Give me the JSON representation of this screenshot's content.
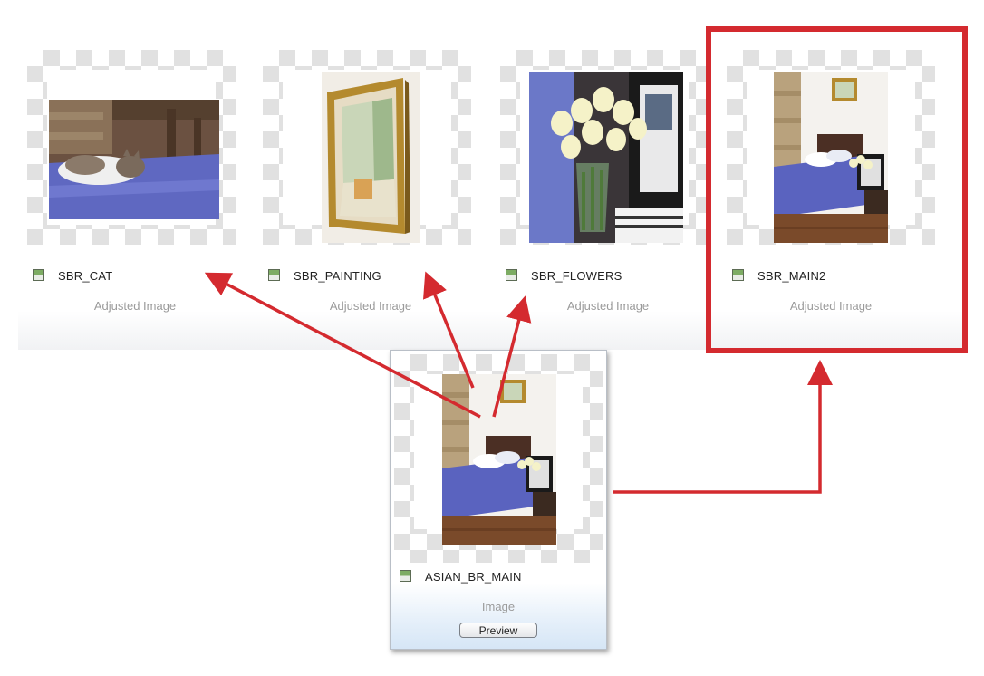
{
  "tiles": [
    {
      "name": "SBR_CAT",
      "subtitle": "Adjusted Image"
    },
    {
      "name": "SBR_PAINTING",
      "subtitle": "Adjusted Image"
    },
    {
      "name": "SBR_FLOWERS",
      "subtitle": "Adjusted Image"
    },
    {
      "name": "SBR_MAIN2",
      "subtitle": "Adjusted Image"
    }
  ],
  "source": {
    "name": "ASIAN_BR_MAIN",
    "subtitle": "Image",
    "button": "Preview"
  },
  "colors": {
    "arrow": "#d42a2f",
    "highlight": "#d42a2f"
  }
}
